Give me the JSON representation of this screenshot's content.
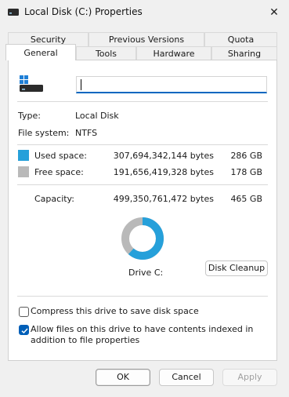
{
  "window": {
    "title": "Local Disk (C:) Properties",
    "close_symbol": "✕"
  },
  "tabs_row1": [
    {
      "label": "Security"
    },
    {
      "label": "Previous Versions"
    },
    {
      "label": "Quota"
    }
  ],
  "tabs_row2": [
    {
      "label": "General",
      "active": true
    },
    {
      "label": "Tools"
    },
    {
      "label": "Hardware"
    },
    {
      "label": "Sharing"
    }
  ],
  "general": {
    "drive_name_value": "",
    "type_label": "Type:",
    "type_value": "Local Disk",
    "fs_label": "File system:",
    "fs_value": "NTFS",
    "used_label": "Used space:",
    "used_bytes": "307,694,342,144 bytes",
    "used_gb": "286 GB",
    "free_label": "Free space:",
    "free_bytes": "191,656,419,328 bytes",
    "free_gb": "178 GB",
    "capacity_label": "Capacity:",
    "capacity_bytes": "499,350,761,472 bytes",
    "capacity_gb": "465 GB",
    "drive_label": "Drive C:",
    "cleanup_button": "Disk Cleanup",
    "used_fraction": 0.616,
    "compress_label": "Compress this drive to save disk space",
    "compress_checked": false,
    "index_label": "Allow files on this drive to have contents indexed in addition to file properties",
    "index_checked": true
  },
  "footer": {
    "ok": "OK",
    "cancel": "Cancel",
    "apply": "Apply"
  },
  "colors": {
    "used": "#26a0da",
    "free": "#b9b9b9",
    "accent": "#005fb8"
  },
  "icons": {
    "title": "drive-icon",
    "drive": "drive-icon",
    "close": "close-icon",
    "check": "checkmark-icon"
  }
}
